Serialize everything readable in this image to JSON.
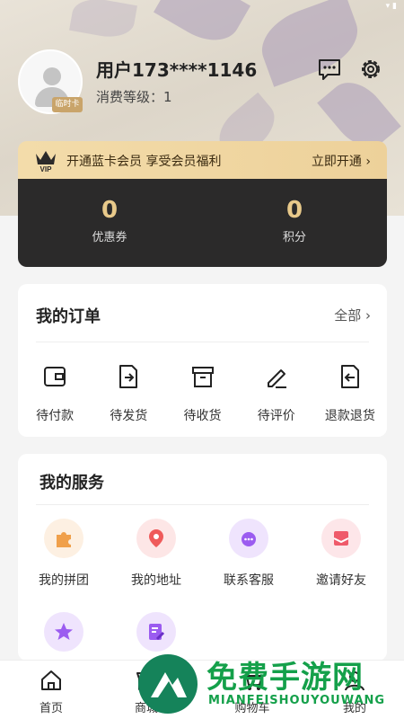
{
  "profile": {
    "username": "用户173****1146",
    "level_text": "消费等级：1",
    "badge": "临时卡"
  },
  "vip": {
    "crown_text": "VIP",
    "promo": "开通蓝卡会员 享受会员福利",
    "open_link": "立即开通"
  },
  "stats": [
    {
      "value": "0",
      "label": "优惠券"
    },
    {
      "value": "0",
      "label": "积分"
    }
  ],
  "orders": {
    "title": "我的订单",
    "all_label": "全部",
    "items": [
      {
        "label": "待付款",
        "icon": "wallet-icon"
      },
      {
        "label": "待发货",
        "icon": "ship-out-icon"
      },
      {
        "label": "待收货",
        "icon": "box-icon"
      },
      {
        "label": "待评价",
        "icon": "pen-icon"
      },
      {
        "label": "退款退货",
        "icon": "refund-icon"
      }
    ]
  },
  "services": {
    "title": "我的服务",
    "items": [
      {
        "label": "我的拼团",
        "icon": "puzzle-icon",
        "color": "#f0a04b"
      },
      {
        "label": "我的地址",
        "icon": "location-pin-icon",
        "color": "#ef5a5a"
      },
      {
        "label": "联系客服",
        "icon": "headset-icon",
        "color": "#9b5cf0"
      },
      {
        "label": "邀请好友",
        "icon": "envelope-icon",
        "color": "#ef5a6a"
      },
      {
        "label": "",
        "icon": "star-icon",
        "color": "#9b5cf0"
      },
      {
        "label": "",
        "icon": "edit-note-icon",
        "color": "#9b5cf0"
      }
    ]
  },
  "tabbar": [
    {
      "label": "首页",
      "icon": "home-icon"
    },
    {
      "label": "商城",
      "icon": "store-icon"
    },
    {
      "label": "购物车",
      "icon": "cart-icon"
    },
    {
      "label": "我的",
      "icon": "user-icon"
    }
  ],
  "watermark": {
    "title": "免费手游网",
    "subtitle": "MIANFEISHOUYOUWANG"
  }
}
